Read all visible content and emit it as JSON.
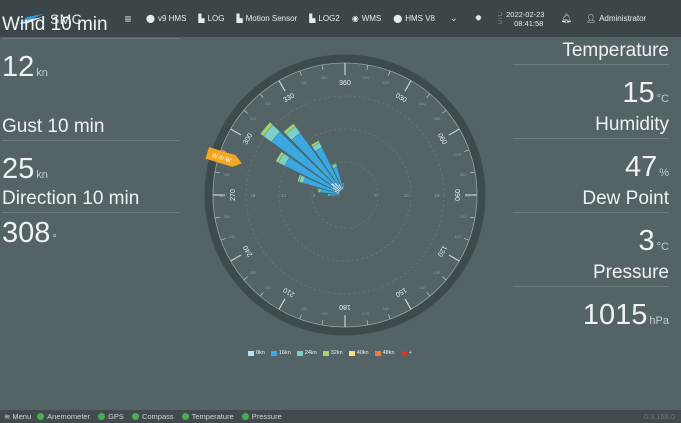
{
  "header": {
    "brand": "SMC",
    "nav": [
      {
        "icon": "circle-letter-icon",
        "label": "v9 HMS"
      },
      {
        "icon": "line-chart-icon",
        "label": "LOG"
      },
      {
        "icon": "line-chart-icon",
        "label": "Motion Sensor"
      },
      {
        "icon": "line-chart-icon",
        "label": "LOG2"
      },
      {
        "icon": "globe-icon",
        "label": "WMS"
      },
      {
        "icon": "circle-letter-icon",
        "label": "HMS V8"
      }
    ],
    "tz": "UTC",
    "date": "2022-02-23",
    "time": "08:41:58",
    "user": "Administrator"
  },
  "left": [
    {
      "label": "Wind 10 min",
      "value": "12",
      "unit": "kn"
    },
    {
      "label": "Gust 10 min",
      "value": "25",
      "unit": "kn"
    },
    {
      "label": "Direction 10 min",
      "value": "308",
      "unit": "°"
    }
  ],
  "right": [
    {
      "label": "Temperature",
      "value": "15",
      "unit": "°C"
    },
    {
      "label": "Humidity",
      "value": "47",
      "unit": "%"
    },
    {
      "label": "Dew Point",
      "value": "3",
      "unit": "°C"
    },
    {
      "label": "Pressure",
      "value": "1015",
      "unit": "hPa"
    }
  ],
  "rose": {
    "heading_labels": [
      "360",
      "030",
      "060",
      "090",
      "120",
      "150",
      "180",
      "210",
      "240",
      "270",
      "300",
      "330"
    ],
    "radial_labels": [
      "24",
      "18",
      "12",
      "6",
      "6",
      "12",
      "18",
      "24"
    ],
    "direction_marker": "W-N-W",
    "bins": [
      {
        "dir": 270,
        "value": 3
      },
      {
        "dir": 280,
        "value": 5
      },
      {
        "dir": 290,
        "value": 9
      },
      {
        "dir": 300,
        "value": 14
      },
      {
        "dir": 310,
        "value": 19
      },
      {
        "dir": 320,
        "value": 16
      },
      {
        "dir": 330,
        "value": 11
      },
      {
        "dir": 340,
        "value": 6
      },
      {
        "dir": 350,
        "value": 2
      }
    ],
    "legend": [
      {
        "label": "8kn",
        "color": "#b9dff2"
      },
      {
        "label": "16kn",
        "color": "#3ba8df"
      },
      {
        "label": "24kn",
        "color": "#7ecfc8"
      },
      {
        "label": "32kn",
        "color": "#a6d26a"
      },
      {
        "label": "40kn",
        "color": "#f6e07a"
      },
      {
        "label": "48kn",
        "color": "#f07a3e"
      },
      {
        "label": "+",
        "color": "#d93030"
      }
    ]
  },
  "status": {
    "menu": "Menu",
    "items": [
      "Anemometer",
      "GPS",
      "Compass",
      "Temperature",
      "Pressure"
    ],
    "ok_color": "#4caf50",
    "version": "0.3.158.0"
  }
}
